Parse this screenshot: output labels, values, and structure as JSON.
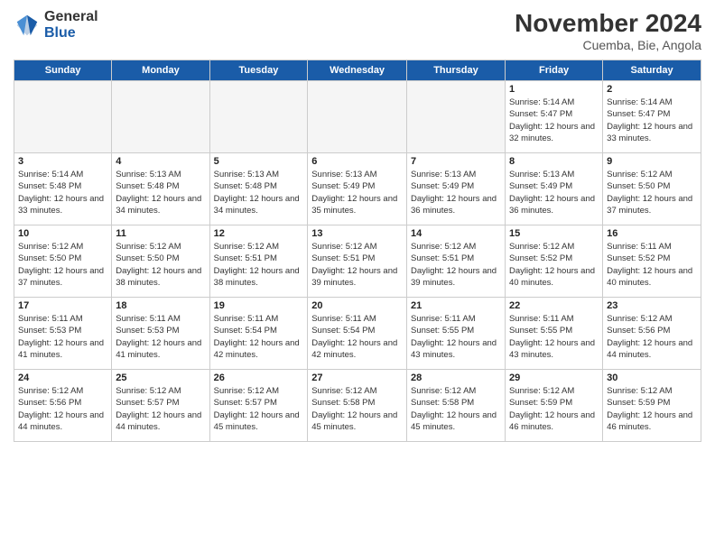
{
  "header": {
    "logo": {
      "general": "General",
      "blue": "Blue"
    },
    "title": "November 2024",
    "subtitle": "Cuemba, Bie, Angola"
  },
  "weekdays": [
    "Sunday",
    "Monday",
    "Tuesday",
    "Wednesday",
    "Thursday",
    "Friday",
    "Saturday"
  ],
  "weeks": [
    [
      {
        "day": "",
        "empty": true
      },
      {
        "day": "",
        "empty": true
      },
      {
        "day": "",
        "empty": true
      },
      {
        "day": "",
        "empty": true
      },
      {
        "day": "",
        "empty": true
      },
      {
        "day": "1",
        "info": "Sunrise: 5:14 AM\nSunset: 5:47 PM\nDaylight: 12 hours\nand 32 minutes."
      },
      {
        "day": "2",
        "info": "Sunrise: 5:14 AM\nSunset: 5:47 PM\nDaylight: 12 hours\nand 33 minutes."
      }
    ],
    [
      {
        "day": "3",
        "info": "Sunrise: 5:14 AM\nSunset: 5:48 PM\nDaylight: 12 hours\nand 33 minutes."
      },
      {
        "day": "4",
        "info": "Sunrise: 5:13 AM\nSunset: 5:48 PM\nDaylight: 12 hours\nand 34 minutes."
      },
      {
        "day": "5",
        "info": "Sunrise: 5:13 AM\nSunset: 5:48 PM\nDaylight: 12 hours\nand 34 minutes."
      },
      {
        "day": "6",
        "info": "Sunrise: 5:13 AM\nSunset: 5:49 PM\nDaylight: 12 hours\nand 35 minutes."
      },
      {
        "day": "7",
        "info": "Sunrise: 5:13 AM\nSunset: 5:49 PM\nDaylight: 12 hours\nand 36 minutes."
      },
      {
        "day": "8",
        "info": "Sunrise: 5:13 AM\nSunset: 5:49 PM\nDaylight: 12 hours\nand 36 minutes."
      },
      {
        "day": "9",
        "info": "Sunrise: 5:12 AM\nSunset: 5:50 PM\nDaylight: 12 hours\nand 37 minutes."
      }
    ],
    [
      {
        "day": "10",
        "info": "Sunrise: 5:12 AM\nSunset: 5:50 PM\nDaylight: 12 hours\nand 37 minutes."
      },
      {
        "day": "11",
        "info": "Sunrise: 5:12 AM\nSunset: 5:50 PM\nDaylight: 12 hours\nand 38 minutes."
      },
      {
        "day": "12",
        "info": "Sunrise: 5:12 AM\nSunset: 5:51 PM\nDaylight: 12 hours\nand 38 minutes."
      },
      {
        "day": "13",
        "info": "Sunrise: 5:12 AM\nSunset: 5:51 PM\nDaylight: 12 hours\nand 39 minutes."
      },
      {
        "day": "14",
        "info": "Sunrise: 5:12 AM\nSunset: 5:51 PM\nDaylight: 12 hours\nand 39 minutes."
      },
      {
        "day": "15",
        "info": "Sunrise: 5:12 AM\nSunset: 5:52 PM\nDaylight: 12 hours\nand 40 minutes."
      },
      {
        "day": "16",
        "info": "Sunrise: 5:11 AM\nSunset: 5:52 PM\nDaylight: 12 hours\nand 40 minutes."
      }
    ],
    [
      {
        "day": "17",
        "info": "Sunrise: 5:11 AM\nSunset: 5:53 PM\nDaylight: 12 hours\nand 41 minutes."
      },
      {
        "day": "18",
        "info": "Sunrise: 5:11 AM\nSunset: 5:53 PM\nDaylight: 12 hours\nand 41 minutes."
      },
      {
        "day": "19",
        "info": "Sunrise: 5:11 AM\nSunset: 5:54 PM\nDaylight: 12 hours\nand 42 minutes."
      },
      {
        "day": "20",
        "info": "Sunrise: 5:11 AM\nSunset: 5:54 PM\nDaylight: 12 hours\nand 42 minutes."
      },
      {
        "day": "21",
        "info": "Sunrise: 5:11 AM\nSunset: 5:55 PM\nDaylight: 12 hours\nand 43 minutes."
      },
      {
        "day": "22",
        "info": "Sunrise: 5:11 AM\nSunset: 5:55 PM\nDaylight: 12 hours\nand 43 minutes."
      },
      {
        "day": "23",
        "info": "Sunrise: 5:12 AM\nSunset: 5:56 PM\nDaylight: 12 hours\nand 44 minutes."
      }
    ],
    [
      {
        "day": "24",
        "info": "Sunrise: 5:12 AM\nSunset: 5:56 PM\nDaylight: 12 hours\nand 44 minutes."
      },
      {
        "day": "25",
        "info": "Sunrise: 5:12 AM\nSunset: 5:57 PM\nDaylight: 12 hours\nand 44 minutes."
      },
      {
        "day": "26",
        "info": "Sunrise: 5:12 AM\nSunset: 5:57 PM\nDaylight: 12 hours\nand 45 minutes."
      },
      {
        "day": "27",
        "info": "Sunrise: 5:12 AM\nSunset: 5:58 PM\nDaylight: 12 hours\nand 45 minutes."
      },
      {
        "day": "28",
        "info": "Sunrise: 5:12 AM\nSunset: 5:58 PM\nDaylight: 12 hours\nand 45 minutes."
      },
      {
        "day": "29",
        "info": "Sunrise: 5:12 AM\nSunset: 5:59 PM\nDaylight: 12 hours\nand 46 minutes."
      },
      {
        "day": "30",
        "info": "Sunrise: 5:12 AM\nSunset: 5:59 PM\nDaylight: 12 hours\nand 46 minutes."
      }
    ]
  ]
}
